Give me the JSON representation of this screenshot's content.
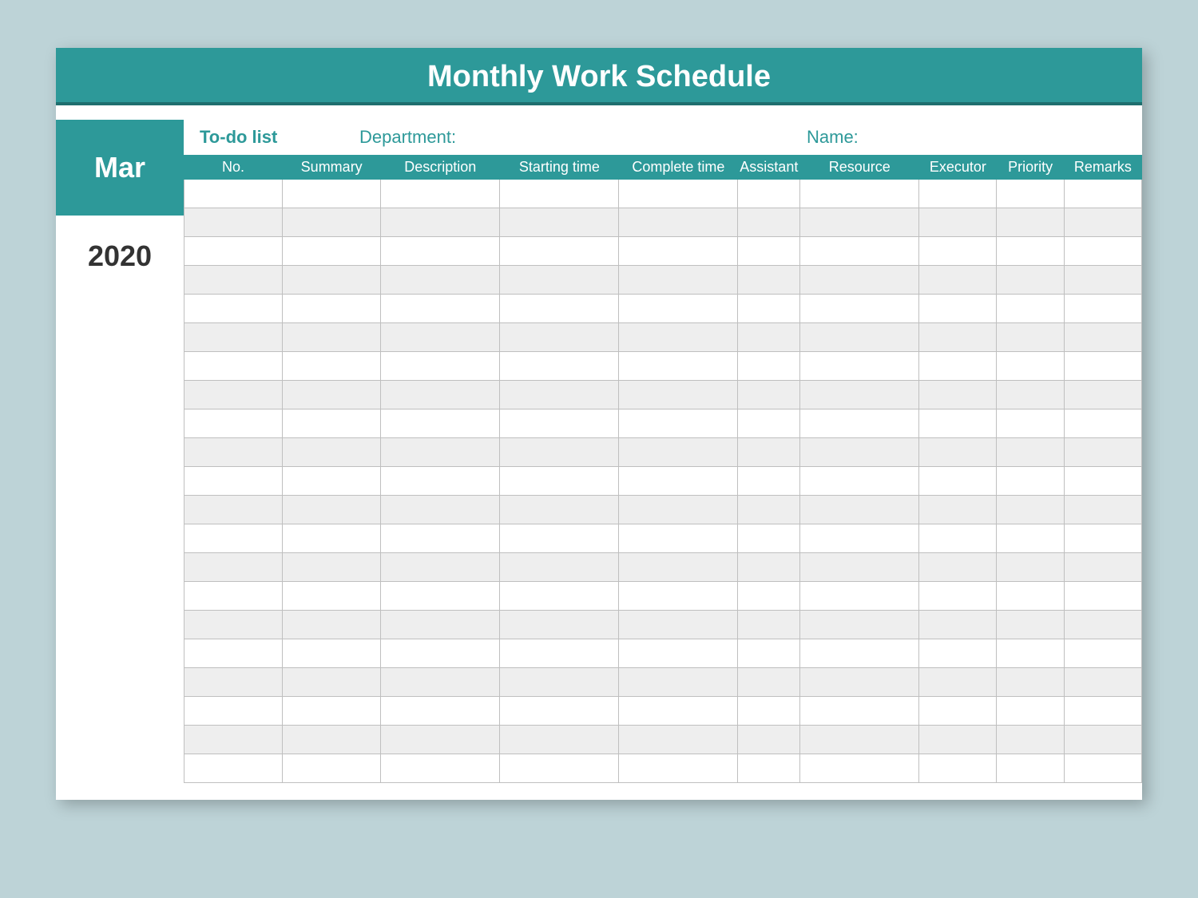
{
  "title": "Monthly Work Schedule",
  "month": "Mar",
  "year": "2020",
  "labels": {
    "todo": "To-do list",
    "department": "Department:",
    "name": "Name:"
  },
  "columns": [
    "No.",
    "Summary",
    "Description",
    "Starting time",
    "Complete time",
    "Assistant",
    "Resource",
    "Executor",
    "Priority",
    "Remarks"
  ],
  "row_count": 21
}
